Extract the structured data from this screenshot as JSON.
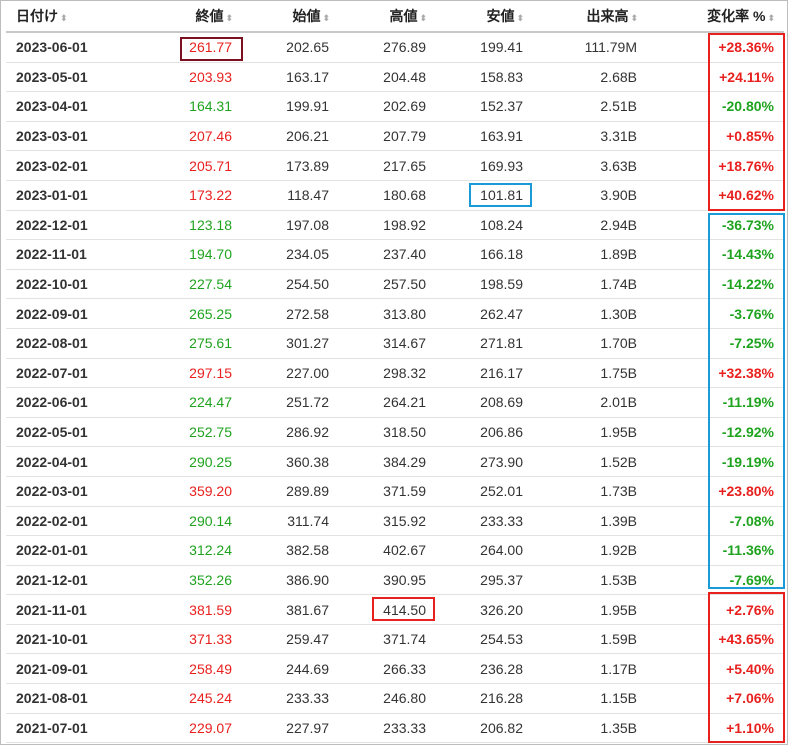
{
  "headers": {
    "date": "日付け",
    "close": "終値",
    "open": "始値",
    "high": "高値",
    "low": "安値",
    "volume": "出来高",
    "change": "変化率 %"
  },
  "sort_icon": "⬍",
  "colors": {
    "up": "#e8211f",
    "down": "#1fa31f",
    "box_dark_red": "#7b1020",
    "box_red": "#e8211f",
    "box_blue": "#1a9ad6"
  },
  "rows": [
    {
      "date": "2023-06-01",
      "close": "261.77",
      "open": "202.65",
      "high": "276.89",
      "low": "199.41",
      "volume": "111.79M",
      "change": "+28.36%",
      "dir": "up"
    },
    {
      "date": "2023-05-01",
      "close": "203.93",
      "open": "163.17",
      "high": "204.48",
      "low": "158.83",
      "volume": "2.68B",
      "change": "+24.11%",
      "dir": "up"
    },
    {
      "date": "2023-04-01",
      "close": "164.31",
      "open": "199.91",
      "high": "202.69",
      "low": "152.37",
      "volume": "2.51B",
      "change": "-20.80%",
      "dir": "down"
    },
    {
      "date": "2023-03-01",
      "close": "207.46",
      "open": "206.21",
      "high": "207.79",
      "low": "163.91",
      "volume": "3.31B",
      "change": "+0.85%",
      "dir": "up"
    },
    {
      "date": "2023-02-01",
      "close": "205.71",
      "open": "173.89",
      "high": "217.65",
      "low": "169.93",
      "volume": "3.63B",
      "change": "+18.76%",
      "dir": "up"
    },
    {
      "date": "2023-01-01",
      "close": "173.22",
      "open": "118.47",
      "high": "180.68",
      "low": "101.81",
      "volume": "3.90B",
      "change": "+40.62%",
      "dir": "up"
    },
    {
      "date": "2022-12-01",
      "close": "123.18",
      "open": "197.08",
      "high": "198.92",
      "low": "108.24",
      "volume": "2.94B",
      "change": "-36.73%",
      "dir": "down"
    },
    {
      "date": "2022-11-01",
      "close": "194.70",
      "open": "234.05",
      "high": "237.40",
      "low": "166.18",
      "volume": "1.89B",
      "change": "-14.43%",
      "dir": "down"
    },
    {
      "date": "2022-10-01",
      "close": "227.54",
      "open": "254.50",
      "high": "257.50",
      "low": "198.59",
      "volume": "1.74B",
      "change": "-14.22%",
      "dir": "down"
    },
    {
      "date": "2022-09-01",
      "close": "265.25",
      "open": "272.58",
      "high": "313.80",
      "low": "262.47",
      "volume": "1.30B",
      "change": "-3.76%",
      "dir": "down"
    },
    {
      "date": "2022-08-01",
      "close": "275.61",
      "open": "301.27",
      "high": "314.67",
      "low": "271.81",
      "volume": "1.70B",
      "change": "-7.25%",
      "dir": "down"
    },
    {
      "date": "2022-07-01",
      "close": "297.15",
      "open": "227.00",
      "high": "298.32",
      "low": "216.17",
      "volume": "1.75B",
      "change": "+32.38%",
      "dir": "up"
    },
    {
      "date": "2022-06-01",
      "close": "224.47",
      "open": "251.72",
      "high": "264.21",
      "low": "208.69",
      "volume": "2.01B",
      "change": "-11.19%",
      "dir": "down"
    },
    {
      "date": "2022-05-01",
      "close": "252.75",
      "open": "286.92",
      "high": "318.50",
      "low": "206.86",
      "volume": "1.95B",
      "change": "-12.92%",
      "dir": "down"
    },
    {
      "date": "2022-04-01",
      "close": "290.25",
      "open": "360.38",
      "high": "384.29",
      "low": "273.90",
      "volume": "1.52B",
      "change": "-19.19%",
      "dir": "down"
    },
    {
      "date": "2022-03-01",
      "close": "359.20",
      "open": "289.89",
      "high": "371.59",
      "low": "252.01",
      "volume": "1.73B",
      "change": "+23.80%",
      "dir": "up"
    },
    {
      "date": "2022-02-01",
      "close": "290.14",
      "open": "311.74",
      "high": "315.92",
      "low": "233.33",
      "volume": "1.39B",
      "change": "-7.08%",
      "dir": "down"
    },
    {
      "date": "2022-01-01",
      "close": "312.24",
      "open": "382.58",
      "high": "402.67",
      "low": "264.00",
      "volume": "1.92B",
      "change": "-11.36%",
      "dir": "down"
    },
    {
      "date": "2021-12-01",
      "close": "352.26",
      "open": "386.90",
      "high": "390.95",
      "low": "295.37",
      "volume": "1.53B",
      "change": "-7.69%",
      "dir": "down"
    },
    {
      "date": "2021-11-01",
      "close": "381.59",
      "open": "381.67",
      "high": "414.50",
      "low": "326.20",
      "volume": "1.95B",
      "change": "+2.76%",
      "dir": "up"
    },
    {
      "date": "2021-10-01",
      "close": "371.33",
      "open": "259.47",
      "high": "371.74",
      "low": "254.53",
      "volume": "1.59B",
      "change": "+43.65%",
      "dir": "up"
    },
    {
      "date": "2021-09-01",
      "close": "258.49",
      "open": "244.69",
      "high": "266.33",
      "low": "236.28",
      "volume": "1.17B",
      "change": "+5.40%",
      "dir": "up"
    },
    {
      "date": "2021-08-01",
      "close": "245.24",
      "open": "233.33",
      "high": "246.80",
      "low": "216.28",
      "volume": "1.15B",
      "change": "+7.06%",
      "dir": "up"
    },
    {
      "date": "2021-07-01",
      "close": "229.07",
      "open": "227.97",
      "high": "233.33",
      "low": "206.82",
      "volume": "1.35B",
      "change": "+1.10%",
      "dir": "up"
    }
  ]
}
